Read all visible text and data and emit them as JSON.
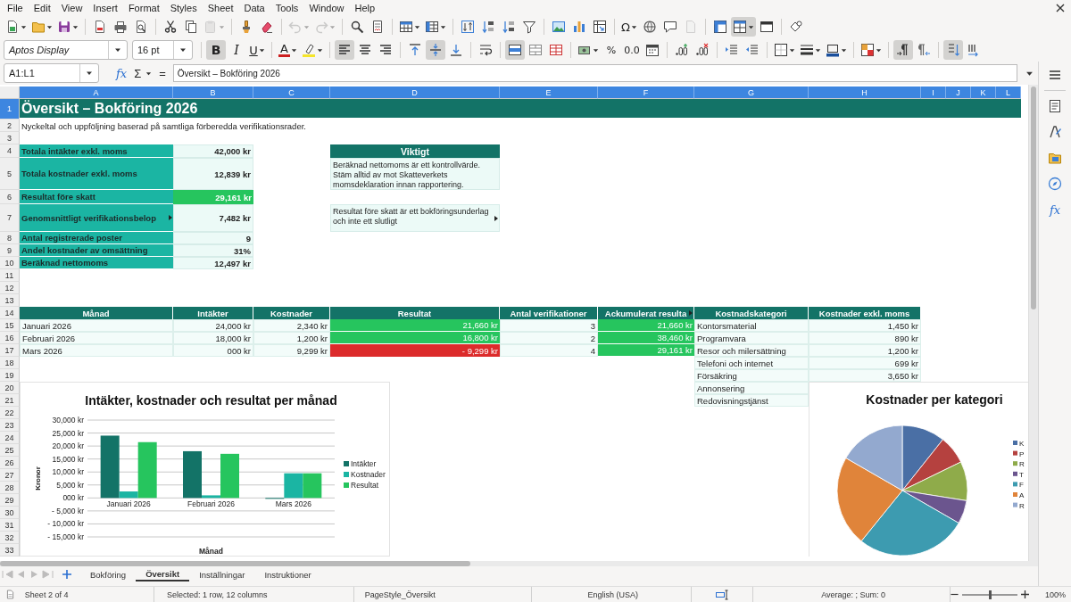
{
  "menu": [
    "File",
    "Edit",
    "View",
    "Insert",
    "Format",
    "Styles",
    "Sheet",
    "Data",
    "Tools",
    "Window",
    "Help"
  ],
  "standard_toolbar": [
    {
      "pressed": false,
      "disabled": false
    },
    {
      "pressed": false,
      "disabled": false
    },
    {
      "pressed": false,
      "disabled": false
    },
    {
      "pressed": false,
      "disabled": false
    },
    {
      "pressed": false,
      "disabled": false
    },
    {
      "pressed": false,
      "disabled": false
    },
    {
      "pressed": false,
      "disabled": false
    },
    {
      "pressed": false,
      "disabled": false
    },
    {
      "pressed": false,
      "disabled": true
    },
    {
      "pressed": false,
      "disabled": false
    },
    {
      "pressed": false,
      "disabled": false
    },
    {
      "pressed": false,
      "disabled": true
    },
    {
      "pressed": false,
      "disabled": true
    },
    {
      "pressed": false,
      "disabled": false
    },
    {
      "pressed": false,
      "disabled": false
    },
    {
      "pressed": false,
      "disabled": false
    },
    {
      "pressed": false,
      "disabled": false
    },
    {
      "pressed": false,
      "disabled": false
    },
    {
      "pressed": false,
      "disabled": false
    },
    {
      "pressed": false,
      "disabled": false
    },
    {
      "pressed": false,
      "disabled": false
    },
    {
      "pressed": false,
      "disabled": false
    },
    {
      "pressed": false,
      "disabled": false
    },
    {
      "pressed": false,
      "disabled": false
    },
    {
      "pressed": false,
      "disabled": false,
      "label": "Ω"
    },
    {
      "pressed": false,
      "disabled": false
    },
    {
      "pressed": false,
      "disabled": false
    },
    {
      "pressed": false,
      "disabled": true
    },
    {
      "pressed": false,
      "disabled": false
    },
    {
      "pressed": true,
      "disabled": false
    },
    {
      "pressed": false,
      "disabled": false
    },
    {
      "pressed": false,
      "disabled": false
    }
  ],
  "formatting_toolbar": {
    "font_name": "Aptos Display",
    "font_size": "16 pt",
    "buttons": [
      {
        "pressed": true,
        "label": "B"
      },
      {
        "pressed": false,
        "label": "I"
      },
      {
        "pressed": false,
        "label": "U"
      },
      {
        "pressed": false,
        "label": "A"
      },
      {
        "pressed": false
      },
      {
        "pressed": true
      },
      {
        "pressed": false
      },
      {
        "pressed": false
      },
      {
        "pressed": false
      },
      {
        "pressed": true
      },
      {
        "pressed": false
      },
      {
        "pressed": false
      },
      {
        "pressed": true
      },
      {
        "pressed": false
      },
      {
        "pressed": false
      },
      {
        "pressed": false
      },
      {
        "pressed": false,
        "label": "%"
      },
      {
        "pressed": false,
        "label": "0.0"
      },
      {
        "pressed": false
      },
      {
        "pressed": false
      },
      {
        "pressed": false
      },
      {
        "pressed": false
      },
      {
        "pressed": false
      },
      {
        "pressed": false
      },
      {
        "pressed": false
      },
      {
        "pressed": false
      },
      {
        "pressed": false
      },
      {
        "pressed": true
      },
      {
        "pressed": false
      },
      {
        "pressed": true
      },
      {
        "pressed": false
      }
    ]
  },
  "formula_bar": {
    "name_box": "A1:L1",
    "function_wizard": "fx",
    "sum": "Σ",
    "equals": "=",
    "content": "Översikt – Bokföring 2026"
  },
  "sheet": {
    "columns": [
      {
        "label": "A",
        "selected": true
      },
      {
        "label": "B",
        "selected": true
      },
      {
        "label": "C",
        "selected": true
      },
      {
        "label": "D",
        "selected": true
      },
      {
        "label": "E",
        "selected": true
      },
      {
        "label": "F",
        "selected": true
      },
      {
        "label": "G",
        "selected": true
      },
      {
        "label": "H",
        "selected": true
      },
      {
        "label": "I",
        "selected": true
      },
      {
        "label": "J",
        "selected": true
      },
      {
        "label": "K",
        "selected": true
      },
      {
        "label": "L",
        "selected": true
      }
    ],
    "rows": [
      {
        "label": "1",
        "selected": true,
        "cells": [
          {
            "kind": "title",
            "text": "Översikt – Bokföring 2026",
            "overflow": false
          }
        ]
      },
      {
        "label": "2",
        "selected": false,
        "cells": [
          {
            "kind": "note",
            "text": "Nyckeltal och uppföljning baserad på samtliga förberedda verifikationsrader.",
            "overflow": false
          }
        ]
      },
      {
        "label": "3",
        "selected": false
      },
      {
        "label": "4",
        "selected": false,
        "cells": [
          {
            "kind": "key",
            "text": "Totala intäkter exkl. moms",
            "overflow": false
          },
          {
            "kind": "total",
            "text": "42,000 kr",
            "overflow": false
          },
          {
            "kind": "empty"
          },
          {
            "kind": "box-header",
            "text": "Viktigt",
            "overflow": false
          }
        ]
      },
      {
        "label": "5",
        "selected": false,
        "cells": [
          {
            "kind": "key",
            "text": "Totala kostnader exkl. moms",
            "overflow": false
          },
          {
            "kind": "total",
            "text": "12,839 kr",
            "overflow": false
          },
          {
            "kind": "empty"
          },
          {
            "kind": "box-text",
            "text": "Beräknad nettomoms är ett kontrollvärde. Stäm alltid av mot Skatteverkets momsdeklaration innan rapportering.",
            "overflow": false
          }
        ]
      },
      {
        "label": "6",
        "selected": false,
        "cells": [
          {
            "kind": "key",
            "text": "Resultat före skatt",
            "overflow": false
          },
          {
            "kind": "total-good",
            "text": "29,161 kr",
            "overflow": false
          }
        ]
      },
      {
        "label": "7",
        "selected": false,
        "cells": [
          {
            "kind": "key",
            "text": "Genomsnittligt verifikationsbelop",
            "overflow": true
          },
          {
            "kind": "total",
            "text": "7,482 kr",
            "overflow": false
          },
          {
            "kind": "empty"
          },
          {
            "kind": "box-text",
            "text": "Resultat före skatt är ett bokföringsunderlag och inte ett slutligt",
            "overflow": true
          }
        ]
      },
      {
        "label": "8",
        "selected": false,
        "cells": [
          {
            "kind": "key",
            "text": "Antal registrerade poster",
            "overflow": false
          },
          {
            "kind": "total",
            "text": "9",
            "overflow": false
          }
        ]
      },
      {
        "label": "9",
        "selected": false,
        "cells": [
          {
            "kind": "key",
            "text": "Andel kostnader av omsättning",
            "overflow": false
          },
          {
            "kind": "total",
            "text": "31%",
            "overflow": false
          }
        ]
      },
      {
        "label": "10",
        "selected": false,
        "cells": [
          {
            "kind": "key",
            "text": "Beräknad nettomoms",
            "overflow": false
          },
          {
            "kind": "total",
            "text": "12,497 kr",
            "overflow": false
          }
        ]
      },
      {
        "label": "11",
        "selected": false
      },
      {
        "label": "12",
        "selected": false
      },
      {
        "label": "13",
        "selected": false
      },
      {
        "label": "14",
        "selected": false,
        "cells": [
          {
            "kind": "header",
            "text": "Månad",
            "overflow": false
          },
          {
            "kind": "header",
            "text": "Intäkter",
            "overflow": false
          },
          {
            "kind": "header",
            "text": "Kostnader",
            "overflow": false
          },
          {
            "kind": "header",
            "text": "Resultat",
            "overflow": false
          },
          {
            "kind": "header",
            "text": "Antal verifikationer",
            "overflow": false
          },
          {
            "kind": "header",
            "text": "Ackumulerat resulta",
            "overflow": true
          },
          {
            "kind": "header",
            "text": "Kostnadskategori",
            "overflow": false
          },
          {
            "kind": "header",
            "text": "Kostnader exkl. moms",
            "overflow": false
          }
        ]
      },
      {
        "label": "15",
        "selected": false,
        "cells": [
          {
            "kind": "text",
            "text": "Januari 2026",
            "overflow": false
          },
          {
            "kind": "amount",
            "text": "24,000 kr",
            "overflow": false
          },
          {
            "kind": "amount",
            "text": "2,340 kr",
            "overflow": false
          },
          {
            "kind": "good",
            "text": "21,660 kr",
            "overflow": false
          },
          {
            "kind": "amount",
            "text": "3",
            "overflow": false
          },
          {
            "kind": "good",
            "text": "21,660 kr",
            "overflow": false
          },
          {
            "kind": "text",
            "text": "Kontorsmaterial",
            "overflow": false
          },
          {
            "kind": "amount",
            "text": "1,450 kr",
            "overflow": false
          }
        ]
      },
      {
        "label": "16",
        "selected": false,
        "cells": [
          {
            "kind": "text",
            "text": "Februari 2026",
            "overflow": false
          },
          {
            "kind": "amount",
            "text": "18,000 kr",
            "overflow": false
          },
          {
            "kind": "amount",
            "text": "1,200 kr",
            "overflow": false
          },
          {
            "kind": "good",
            "text": "16,800 kr",
            "overflow": false
          },
          {
            "kind": "amount",
            "text": "2",
            "overflow": false
          },
          {
            "kind": "good",
            "text": "38,460 kr",
            "overflow": false
          },
          {
            "kind": "text",
            "text": "Programvara",
            "overflow": false
          },
          {
            "kind": "amount",
            "text": "890 kr",
            "overflow": false
          }
        ]
      },
      {
        "label": "17",
        "selected": false,
        "cells": [
          {
            "kind": "text",
            "text": "Mars 2026",
            "overflow": false
          },
          {
            "kind": "amount",
            "text": "000 kr",
            "overflow": false
          },
          {
            "kind": "amount",
            "text": "9,299 kr",
            "overflow": false
          },
          {
            "kind": "bad",
            "text": "- 9,299 kr",
            "overflow": false
          },
          {
            "kind": "amount",
            "text": "4",
            "overflow": false
          },
          {
            "kind": "good",
            "text": "29,161 kr",
            "overflow": false
          },
          {
            "kind": "text",
            "text": "Resor och milersättning",
            "overflow": false
          },
          {
            "kind": "amount",
            "text": "1,200 kr",
            "overflow": false
          }
        ]
      },
      {
        "label": "18",
        "selected": false,
        "cells": [
          {
            "kind": "empty"
          },
          {
            "kind": "empty"
          },
          {
            "kind": "empty"
          },
          {
            "kind": "empty"
          },
          {
            "kind": "empty"
          },
          {
            "kind": "empty"
          },
          {
            "kind": "text",
            "text": "Telefoni och internet",
            "overflow": false
          },
          {
            "kind": "amount",
            "text": "699 kr",
            "overflow": false
          }
        ]
      },
      {
        "label": "19",
        "selected": false,
        "cells": [
          {
            "kind": "empty"
          },
          {
            "kind": "empty"
          },
          {
            "kind": "empty"
          },
          {
            "kind": "empty"
          },
          {
            "kind": "empty"
          },
          {
            "kind": "empty"
          },
          {
            "kind": "text",
            "text": "Försäkring",
            "overflow": false
          },
          {
            "kind": "amount",
            "text": "3,650 kr",
            "overflow": false
          }
        ]
      },
      {
        "label": "20",
        "selected": false,
        "cells": [
          {
            "kind": "empty"
          },
          {
            "kind": "empty"
          },
          {
            "kind": "empty"
          },
          {
            "kind": "empty"
          },
          {
            "kind": "empty"
          },
          {
            "kind": "empty"
          },
          {
            "kind": "text",
            "text": "Annonsering",
            "overflow": false
          }
        ]
      },
      {
        "label": "21",
        "selected": false,
        "cells": [
          {
            "kind": "empty"
          },
          {
            "kind": "empty"
          },
          {
            "kind": "empty"
          },
          {
            "kind": "empty"
          },
          {
            "kind": "empty"
          },
          {
            "kind": "empty"
          },
          {
            "kind": "text",
            "text": "Redovisningstjänst",
            "overflow": false
          }
        ]
      },
      {
        "label": "22",
        "selected": false
      },
      {
        "label": "23",
        "selected": false
      },
      {
        "label": "24",
        "selected": false
      },
      {
        "label": "25",
        "selected": false
      },
      {
        "label": "26",
        "selected": false
      },
      {
        "label": "27",
        "selected": false
      },
      {
        "label": "28",
        "selected": false
      },
      {
        "label": "29",
        "selected": false
      },
      {
        "label": "30",
        "selected": false
      },
      {
        "label": "31",
        "selected": false
      },
      {
        "label": "32",
        "selected": false
      },
      {
        "label": "33",
        "selected": false
      }
    ]
  },
  "charts": [
    {
      "chart_data": {
        "type": "bar",
        "title": "Intäkter, kostnader och resultat per månad",
        "xlabel": "Månad",
        "ylabel": "Kronor",
        "categories": [
          "Januari 2026",
          "Februari 2026",
          "Mars 2026"
        ],
        "series": [
          {
            "name": "Intäkter",
            "color": "#137367",
            "values": [
              24000,
              18000,
              0
            ]
          },
          {
            "name": "Kostnader",
            "color": "#1bb5a3",
            "values": [
              2500,
              1000,
              9500
            ]
          },
          {
            "name": "Resultat",
            "color": "#26c55e",
            "values": [
              21500,
              17000,
              9500
            ]
          }
        ],
        "grid": true,
        "legend": true,
        "ylim": [
          -15000,
          30000
        ],
        "yticks": [
          {
            "value": 30000,
            "label": "30,000 kr"
          },
          {
            "value": 25000,
            "label": "25,000 kr"
          },
          {
            "value": 20000,
            "label": "20,000 kr"
          },
          {
            "value": 15000,
            "label": "15,000 kr"
          },
          {
            "value": 10000,
            "label": "10,000 kr"
          },
          {
            "value": 5000,
            "label": "5,000 kr"
          },
          {
            "value": 0,
            "label": "000 kr"
          },
          {
            "value": -5000,
            "label": "- 5,000 kr"
          },
          {
            "value": -10000,
            "label": "- 10,000 kr"
          },
          {
            "value": -15000,
            "label": "- 15,000 kr"
          }
        ]
      }
    }
  ],
  "pie_chart": {
    "title": "Kostnader per kategori",
    "legend": [
      {
        "label": "K",
        "color": "#4a6fa5"
      },
      {
        "label": "P",
        "color": "#b5413f"
      },
      {
        "label": "R",
        "color": "#8fab4a"
      },
      {
        "label": "T",
        "color": "#6b558e"
      },
      {
        "label": "F",
        "color": "#3d9bb0"
      },
      {
        "label": "A",
        "color": "#e0843a"
      },
      {
        "label": "R",
        "color": "#93a9cf"
      }
    ]
  },
  "sidebar": {
    "function_label": "fx"
  },
  "sheet_tabs": [
    {
      "label": "Bokföring",
      "selected": false
    },
    {
      "label": "Översikt",
      "selected": true
    },
    {
      "label": "Inställningar",
      "selected": false
    },
    {
      "label": "Instruktioner",
      "selected": false
    }
  ],
  "status_bar": {
    "sheet": "Sheet 2 of 4",
    "selection": "Selected: 1 row, 12 columns",
    "page_style": "PageStyle_Översikt",
    "language": "English (USA)",
    "summary": "Average: ; Sum: 0",
    "zoom": {
      "level": 0.5
    },
    "zoom_percent": "100%"
  }
}
